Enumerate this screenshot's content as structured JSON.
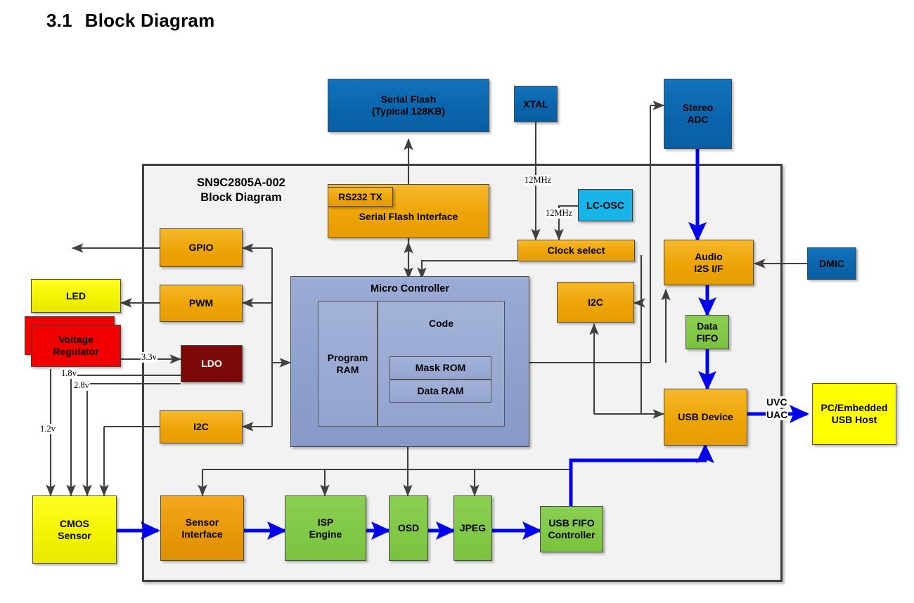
{
  "heading": {
    "number": "3.1",
    "text": "Block Diagram"
  },
  "chip": {
    "title_line1": "SN9C2805A-002",
    "title_line2": "Block Diagram"
  },
  "blocks": {
    "serial_flash": {
      "line1": "Serial Flash",
      "line2": "(Typical 128KB)",
      "color": "#0a64ab"
    },
    "xtal": {
      "label": "XTAL",
      "color": "#0a64ab"
    },
    "stereo_adc": {
      "line1": "Stereo",
      "line2": "ADC",
      "color": "#0a64ab"
    },
    "rs232_tx": {
      "label": "RS232 TX",
      "color": "#eda406"
    },
    "serial_flash_if": {
      "label": "Serial Flash Interface",
      "color": "#eda406"
    },
    "lc_osc": {
      "label": "LC-OSC",
      "color": "#18b3e8"
    },
    "clock_select": {
      "label": "Clock select",
      "color": "#eda406"
    },
    "audio_i2s": {
      "line1": "Audio",
      "line2": "I2S I/F",
      "color": "#eda406"
    },
    "dmic": {
      "label": "DMIC",
      "color": "#0a64ab"
    },
    "gpio": {
      "label": "GPIO",
      "color": "#eda406"
    },
    "pwm": {
      "label": "PWM",
      "color": "#eda406"
    },
    "led": {
      "label": "LED",
      "color": "#ffff00"
    },
    "voltage_regulator": {
      "line1": "Voltage",
      "line2": "Regulator",
      "color": "#f20000"
    },
    "ldo": {
      "label": "LDO",
      "color": "#7d0808"
    },
    "i2c_left": {
      "label": "I2C",
      "color": "#eda406"
    },
    "i2c_right": {
      "label": "I2C",
      "color": "#eda406"
    },
    "micro_controller": {
      "label": "Micro Controller",
      "color": "#8d9fcd"
    },
    "program_ram": {
      "line1": "Program",
      "line2": "RAM"
    },
    "code": {
      "label": "Code"
    },
    "mask_rom": {
      "label": "Mask ROM"
    },
    "data_ram": {
      "label": "Data RAM"
    },
    "data_fifo": {
      "line1": "Data",
      "line2": "FIFO",
      "color": "#81c846"
    },
    "usb_device": {
      "label": "USB Device",
      "color": "#eda406"
    },
    "pc_usb_host": {
      "line1": "PC/Embedded",
      "line2": "USB Host",
      "color": "#ffff00"
    },
    "cmos_sensor": {
      "line1": "CMOS",
      "line2": "Sensor",
      "color": "#f2f200"
    },
    "sensor_interface": {
      "line1": "Sensor",
      "line2": "Interface",
      "color": "#e79806"
    },
    "isp_engine": {
      "line1": "ISP",
      "line2": "Engine",
      "color": "#81c846"
    },
    "osd": {
      "label": "OSD",
      "color": "#81c846"
    },
    "jpeg": {
      "label": "JPEG",
      "color": "#81c846"
    },
    "usb_fifo_controller": {
      "line1": "USB FIFO",
      "line2": "Controller",
      "color": "#81c846"
    }
  },
  "wire_labels": {
    "xtal_freq": "12MHz",
    "lcosc_freq": "12MHz",
    "v33": "3.3v",
    "v18": "1.8v",
    "v28": "2.8v",
    "v12": "1.2v",
    "uvc": "UVC",
    "uac": "UAC"
  },
  "colors": {
    "data_path": "#0000ee",
    "control_path": "#404040",
    "frame": "#3f3f3f",
    "chip_bg": "#f2f2f2"
  }
}
